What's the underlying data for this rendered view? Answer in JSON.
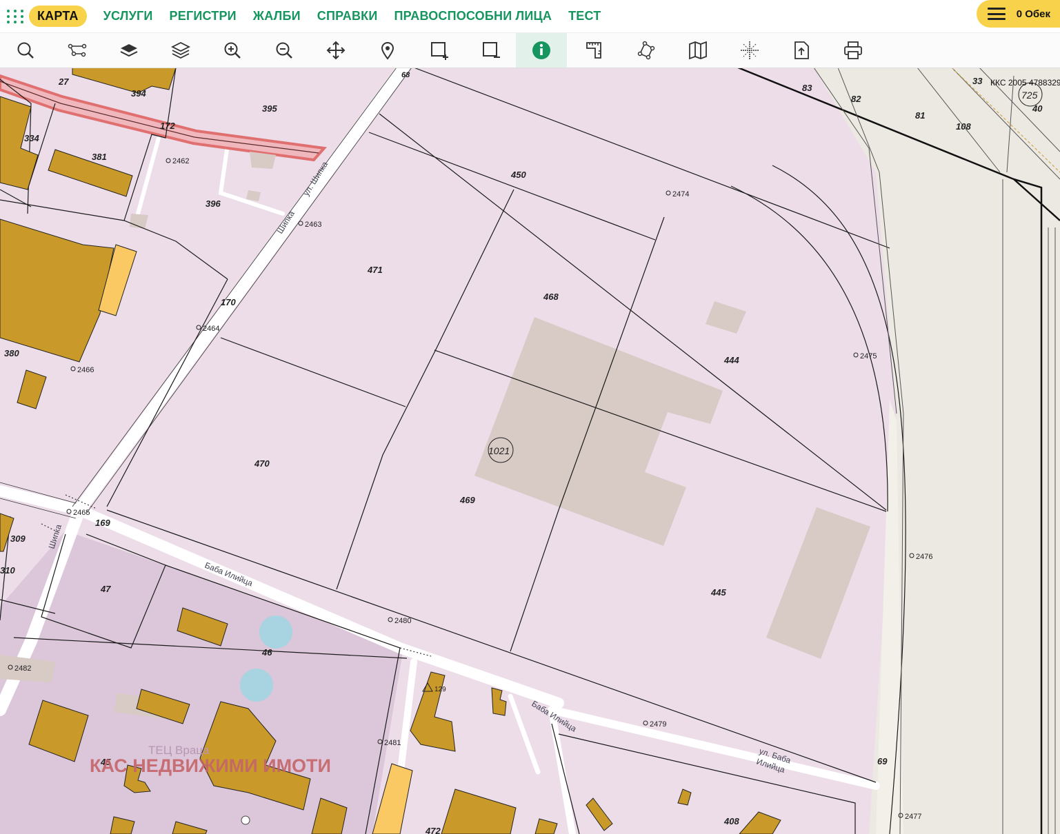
{
  "nav": {
    "items": [
      {
        "label": "КАРТА",
        "active": true
      },
      {
        "label": "УСЛУГИ"
      },
      {
        "label": "РЕГИСТРИ"
      },
      {
        "label": "ЖАЛБИ"
      },
      {
        "label": "СПРАВКИ"
      },
      {
        "label": "ПРАВОСПОСОБНИ ЛИЦА"
      },
      {
        "label": "ТЕСТ"
      }
    ],
    "cart_label": "0 Обек"
  },
  "toolbar": {
    "tools": [
      "search-icon",
      "route-icon",
      "layer-icon",
      "layers-icon",
      "zoom-in-icon",
      "zoom-out-icon",
      "pan-icon",
      "marker-icon",
      "select-add-icon",
      "select-remove-icon",
      "info-icon",
      "measure-icon",
      "polygon-icon",
      "map-icon",
      "crosshair-icon",
      "export-icon",
      "print-icon"
    ],
    "active_tool": "info-icon"
  },
  "map": {
    "kks_label": "ККС 2005 4788329",
    "sheet_label": "725",
    "cadastral_label": "1021",
    "watermark": "КАС НЕДВИЖИМИ ИМОТИ",
    "faded_label": "ТЕЦ Враца",
    "parcel_labels": [
      "394",
      "395",
      "27",
      "172",
      "334",
      "381",
      "396",
      "471",
      "468",
      "450",
      "444",
      "170",
      "380",
      "470",
      "469",
      "445",
      "309",
      "310",
      "169",
      "47",
      "46",
      "45",
      "129",
      "472",
      "408",
      "69",
      "68",
      "83",
      "82",
      "81",
      "108",
      "33",
      "40"
    ],
    "point_labels": [
      "2462",
      "2463",
      "2464",
      "2466",
      "2465",
      "2474",
      "2475",
      "2476",
      "2480",
      "2479",
      "2481",
      "2482",
      "2477"
    ],
    "street_labels": [
      "ул. Шипка",
      "Шипка",
      "Шипка",
      "Баба Илийца",
      "Баба Илийца",
      "ул. Баба",
      "Илийца"
    ],
    "colors": {
      "parcel_bg": "#ecdde8",
      "building": "#c99a2a",
      "building_light": "#fbc964",
      "planned": "#d8cac5",
      "road": "#ffffff",
      "highlight": "#e07070",
      "water": "#a8d4e2",
      "accent": "#16955f",
      "cart": "#f8d24a"
    }
  }
}
